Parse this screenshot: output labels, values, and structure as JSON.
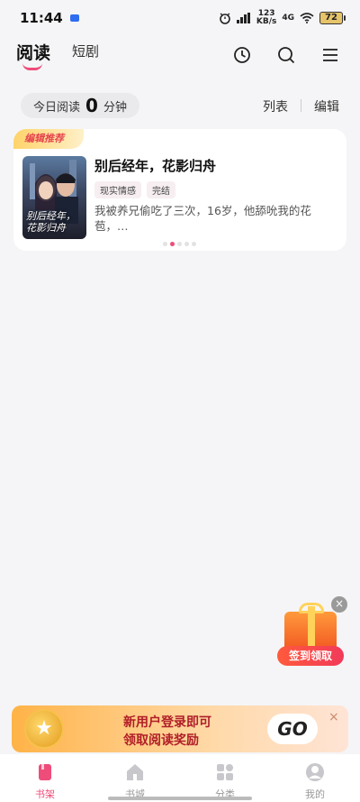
{
  "status_bar": {
    "time": "11:44",
    "speed_top": "123",
    "speed_bottom": "KB/s",
    "network": "4G",
    "battery": "72"
  },
  "header": {
    "tab_read": "阅读",
    "tab_short_drama": "短剧",
    "icons": [
      "clock-icon",
      "search-icon",
      "menu-icon"
    ]
  },
  "reading_stats": {
    "prefix": "今日阅读",
    "minutes": "0",
    "suffix": "分钟",
    "list_label": "列表",
    "edit_label": "编辑"
  },
  "recommend_card": {
    "badge": "编辑推荐",
    "title": "别后经年，花影归舟",
    "tags": [
      "现实情感",
      "完结"
    ],
    "description": "我被养兄偷吃了三次，16岁，他舔吮我的花苞，…",
    "cover_text_line1": "别后经年，",
    "cover_text_line2": "花影归舟",
    "page_dots": 5,
    "active_dot": 1
  },
  "gift_widget": {
    "label": "签到领取",
    "close": "×"
  },
  "banner": {
    "line1": "新用户登录即可",
    "line2": "领取阅读奖励",
    "go_label": "GO",
    "close": "×"
  },
  "bottom_nav": {
    "items": [
      {
        "label": "书架",
        "icon": "bookshelf-icon",
        "active": true
      },
      {
        "label": "书城",
        "icon": "bookstore-icon",
        "active": false
      },
      {
        "label": "分类",
        "icon": "category-icon",
        "active": false
      },
      {
        "label": "我的",
        "icon": "profile-icon",
        "active": false
      }
    ]
  },
  "colors": {
    "accent": "#ee4c7a",
    "background": "#f5f5f7"
  }
}
